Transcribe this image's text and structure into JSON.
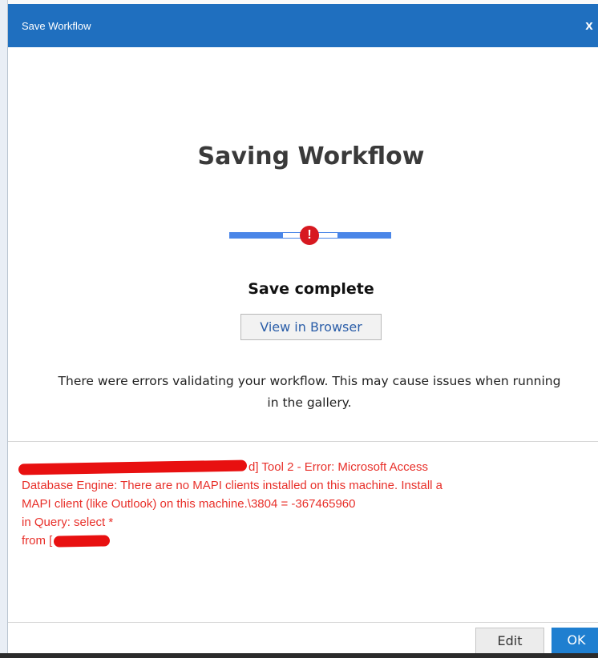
{
  "dialog": {
    "title": "Save Workflow",
    "close_label": "x"
  },
  "main": {
    "heading": "Saving Workflow",
    "progress_error_symbol": "!",
    "status": "Save complete",
    "view_in_browser_label": "View in Browser",
    "warning_line1": "There were errors validating your workflow. This may cause issues when running",
    "warning_line2": "in the gallery."
  },
  "error": {
    "line1_tail": "d] Tool 2 - Error: Microsoft Access",
    "line2": "Database Engine: There are no MAPI clients installed on this machine. Install a",
    "line3": "MAPI client (like Outlook) on this machine.\\3804 = -367465960",
    "line4": "in Query: select *",
    "line5_prefix": "from ["
  },
  "footer": {
    "edit_label": "Edit",
    "ok_label": "OK"
  },
  "colors": {
    "titlebar": "#1f6fbf",
    "progress": "#4a86e8",
    "error_text": "#e8302a",
    "error_icon": "#d71920",
    "ok_button": "#1f7fd0"
  }
}
